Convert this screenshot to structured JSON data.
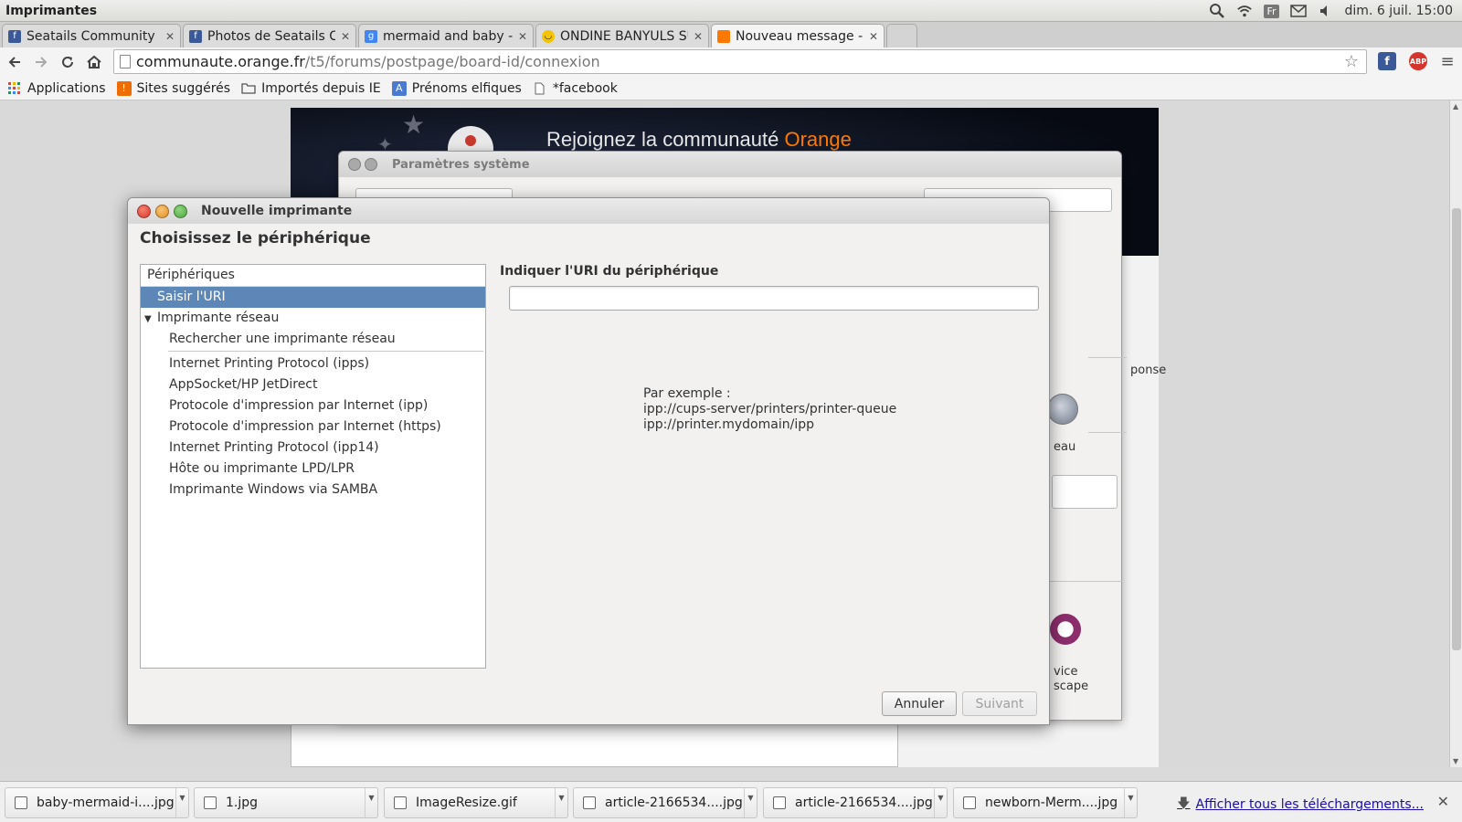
{
  "system_bar": {
    "app_name": "Imprimantes",
    "keyboard_layout": "Fr",
    "datetime": "dim. 6 juil. 15:00"
  },
  "tabs": [
    {
      "label": "Seatails Community",
      "favicon": "keyboard-fb-icon",
      "color": "#3b5998"
    },
    {
      "label": "Photos de Seatails Co",
      "favicon": "facebook-icon",
      "color": "#3b5998"
    },
    {
      "label": "mermaid and baby - R",
      "favicon": "google-icon",
      "color": "#4285f4"
    },
    {
      "label": "ONDINE BANYULS SU",
      "favicon": "smiley-icon",
      "color": "#f5c400"
    },
    {
      "label": "Nouveau message - C",
      "favicon": "orange-icon",
      "color": "#ff7900",
      "active": true
    }
  ],
  "address_bar": {
    "host": "communaute.orange.fr",
    "path": "/t5/forums/postpage/board-id/connexion"
  },
  "bookmarks": [
    {
      "label": "Applications",
      "icon": "apps-grid-icon"
    },
    {
      "label": "Sites suggérés",
      "icon": "suggested-icon"
    },
    {
      "label": "Importés depuis IE",
      "icon": "folder-icon"
    },
    {
      "label": "Prénoms elfiques",
      "icon": "translate-icon"
    },
    {
      "label": "*facebook",
      "icon": "page-icon"
    }
  ],
  "page_banner": {
    "title_prefix": "Rejoignez la communauté ",
    "title_brand": "Orange",
    "brand_color": "#ff7900"
  },
  "system_settings": {
    "title": "Paramètres système",
    "peek_texts": [
      "ponse",
      "eau",
      "vice",
      "scape"
    ]
  },
  "dialog": {
    "title": "Nouvelle imprimante",
    "heading": "Choisissez le périphérique",
    "device_list": {
      "header": "Périphériques",
      "selected_item": "Saisir l'URI",
      "group_label": "Imprimante réseau",
      "search_item": "Rechercher une imprimante réseau",
      "protocols": [
        "Internet Printing Protocol (ipps)",
        "AppSocket/HP JetDirect",
        "Protocole d'impression par Internet (ipp)",
        "Protocole d'impression par Internet (https)",
        "Internet Printing Protocol (ipp14)",
        "Hôte ou imprimante LPD/LPR",
        "Imprimante Windows via SAMBA"
      ]
    },
    "uri_section": {
      "label": "Indiquer l'URI du périphérique",
      "value": "",
      "example_title": "Par exemple :",
      "example_lines": [
        "ipp://cups-server/printers/printer-queue",
        "ipp://printer.mydomain/ipp"
      ]
    },
    "buttons": {
      "cancel": "Annuler",
      "next": "Suivant"
    }
  },
  "downloads": {
    "items": [
      "baby-mermaid-i....jpg",
      "1.jpg",
      "ImageResize.gif",
      "article-2166534....jpg",
      "article-2166534....jpg",
      "newborn-Merm....jpg"
    ],
    "show_all": "Afficher tous les téléchargements..."
  }
}
